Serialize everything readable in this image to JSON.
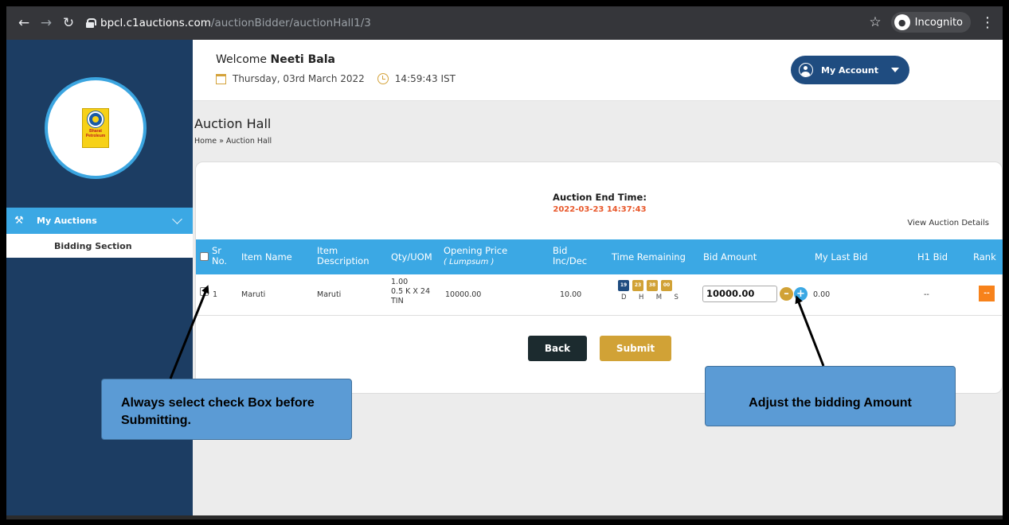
{
  "browser": {
    "url_host": "bpcl.c1auctions.com",
    "url_path": "/auctionBidder/auctionHall1/3",
    "incognito_label": "Incognito"
  },
  "sidebar": {
    "logo_text": [
      "Bharat",
      "Petroleum"
    ],
    "section_label": "My Auctions",
    "items": [
      {
        "label": "Bidding Section"
      }
    ]
  },
  "header": {
    "welcome_prefix": "Welcome",
    "user_name": "Neeti Bala",
    "date": "Thursday, 03rd March 2022",
    "time": "14:59:43 IST",
    "account_label": "My Account"
  },
  "page": {
    "title": "Auction Hall",
    "breadcrumb": "Home » Auction Hall"
  },
  "auction": {
    "end_time_label": "Auction End Time:",
    "end_time": "2022-03-23 14:37:43",
    "view_details": "View Auction Details"
  },
  "table": {
    "headers": {
      "sr": [
        "Sr",
        "No."
      ],
      "item_name": "Item Name",
      "item_desc": [
        "Item",
        "Description"
      ],
      "qty": "Qty/UOM",
      "opening_price": [
        "Opening Price",
        "( Lumpsum )"
      ],
      "bid_incdec": [
        "Bid",
        "Inc/Dec"
      ],
      "time_remaining": "Time Remaining",
      "bid_amount": "Bid Amount",
      "my_last_bid": "My Last Bid",
      "h1_bid": "H1 Bid",
      "rank": "Rank"
    },
    "rows": [
      {
        "sr": "1",
        "item_name": "Maruti",
        "item_desc": "Maruti",
        "qty": [
          "1.00",
          "0.5 K X 24",
          "TIN"
        ],
        "opening_price": "10000.00",
        "bid_incdec": "10.00",
        "time": {
          "d": "19",
          "h": "23",
          "m": "38",
          "s": "00"
        },
        "time_labels": "D  H  M  S",
        "bid_amount": "10000.00",
        "my_last_bid": "0.00",
        "h1_bid": "--",
        "rank": "--"
      }
    ]
  },
  "buttons": {
    "back": "Back",
    "submit": "Submit"
  },
  "callouts": {
    "checkbox": "Always select check Box before Submitting.",
    "bid": "Adjust the bidding Amount"
  },
  "colors": {
    "sidebar_bg": "#1c3d63",
    "accent_blue": "#3ba8e4",
    "end_time": "#e8572a",
    "submit": "#d1a236",
    "rank": "#f7821b"
  }
}
